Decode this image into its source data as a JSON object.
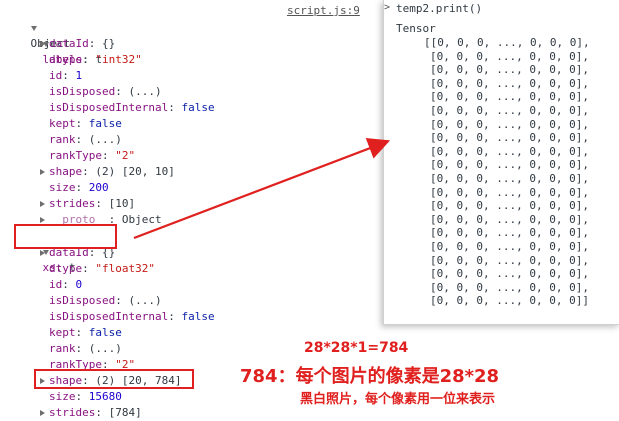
{
  "console": {
    "object_label": "Object",
    "source_link": "script.js:9",
    "labels": {
      "key": "labels",
      "type": "t",
      "rows": [
        {
          "key": "dataId",
          "val": "{}",
          "kind": "plain",
          "expand": true
        },
        {
          "key": "dtype",
          "val": "\"int32\"",
          "kind": "str"
        },
        {
          "key": "id",
          "val": "1",
          "kind": "num"
        },
        {
          "key": "isDisposed",
          "val": "(...)",
          "kind": "plain"
        },
        {
          "key": "isDisposedInternal",
          "val": "false",
          "kind": "kw"
        },
        {
          "key": "kept",
          "val": "false",
          "kind": "kw"
        },
        {
          "key": "rank",
          "val": "(...)",
          "kind": "plain"
        },
        {
          "key": "rankType",
          "val": "\"2\"",
          "kind": "str"
        },
        {
          "key": "shape",
          "val": "(2) [20, 10]",
          "kind": "plain",
          "expand": true
        },
        {
          "key": "size",
          "val": "200",
          "kind": "num"
        },
        {
          "key": "strides",
          "val": "[10]",
          "kind": "plain",
          "expand": true
        },
        {
          "key": "__proto__",
          "val": "Object",
          "kind": "plain",
          "expand": true,
          "dim": true
        }
      ]
    },
    "xs": {
      "key": "xs",
      "type": "t",
      "rows": [
        {
          "key": "dataId",
          "val": "{}",
          "kind": "plain",
          "expand": true
        },
        {
          "key": "dtype",
          "val": "\"float32\"",
          "kind": "str"
        },
        {
          "key": "id",
          "val": "0",
          "kind": "num"
        },
        {
          "key": "isDisposed",
          "val": "(...)",
          "kind": "plain"
        },
        {
          "key": "isDisposedInternal",
          "val": "false",
          "kind": "kw"
        },
        {
          "key": "kept",
          "val": "false",
          "kind": "kw"
        },
        {
          "key": "rank",
          "val": "(...)",
          "kind": "plain"
        },
        {
          "key": "rankType",
          "val": "\"2\"",
          "kind": "str"
        },
        {
          "key": "shape",
          "val": "(2) [20, 784]",
          "kind": "plain",
          "expand": true
        },
        {
          "key": "size",
          "val": "15680",
          "kind": "num"
        },
        {
          "key": "strides",
          "val": "[784]",
          "kind": "plain",
          "expand": true
        }
      ]
    }
  },
  "print_panel": {
    "command": "temp2.print()",
    "header": "Tensor",
    "first_row": "[[0, 0, 0, ..., 0, 0, 0],",
    "middle_row": "[0, 0, 0, ..., 0, 0, 0],",
    "last_row": "[0, 0, 0, ..., 0, 0, 0]]",
    "middle_row_count": 18
  },
  "annotations": {
    "formula": "28*28*1=784",
    "main_note": "784：每个图片的像素是28*28",
    "sub_note": "黑白照片，每个像素用一位来表示"
  },
  "colors": {
    "annotation_red": "#e0201e",
    "key_purple": "#881280",
    "string_red": "#c41a16",
    "number_blue": "#1c00cf"
  }
}
